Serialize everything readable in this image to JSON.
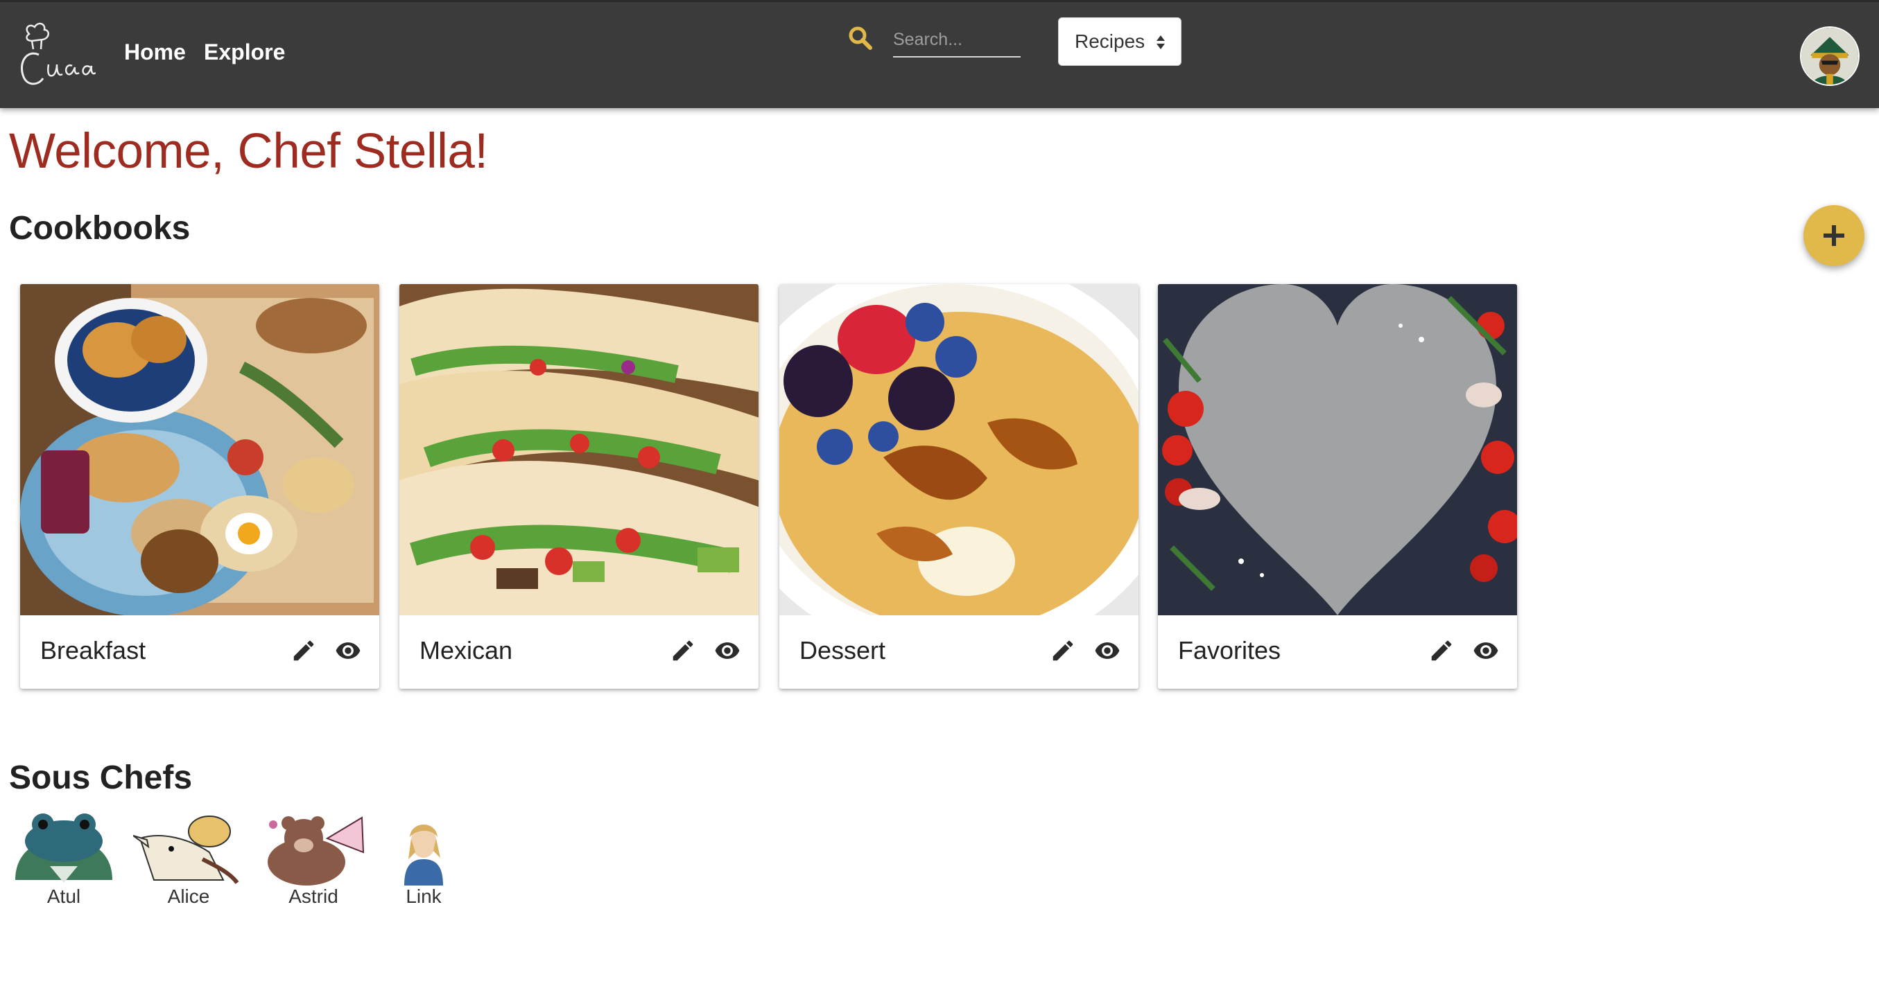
{
  "header": {
    "nav_links": [
      "Home",
      "Explore"
    ],
    "search_placeholder": "Search...",
    "search_type": "Recipes",
    "accent_color": "#e1b94b"
  },
  "welcome_text": "Welcome, Chef Stella!",
  "cookbooks": {
    "heading": "Cookbooks",
    "items": [
      {
        "title": "Breakfast"
      },
      {
        "title": "Mexican"
      },
      {
        "title": "Dessert"
      },
      {
        "title": "Favorites"
      }
    ]
  },
  "sous_chefs": {
    "heading": "Sous Chefs",
    "items": [
      {
        "name": "Atul"
      },
      {
        "name": "Alice"
      },
      {
        "name": "Astrid"
      },
      {
        "name": "Link"
      }
    ]
  },
  "icons": {
    "search": "search-icon",
    "add": "plus-icon",
    "edit": "pencil-icon",
    "view": "eye-icon"
  },
  "colors": {
    "navbar": "#3b3b3b",
    "welcome": "#9e2b1f",
    "fab": "#e1b94b"
  }
}
